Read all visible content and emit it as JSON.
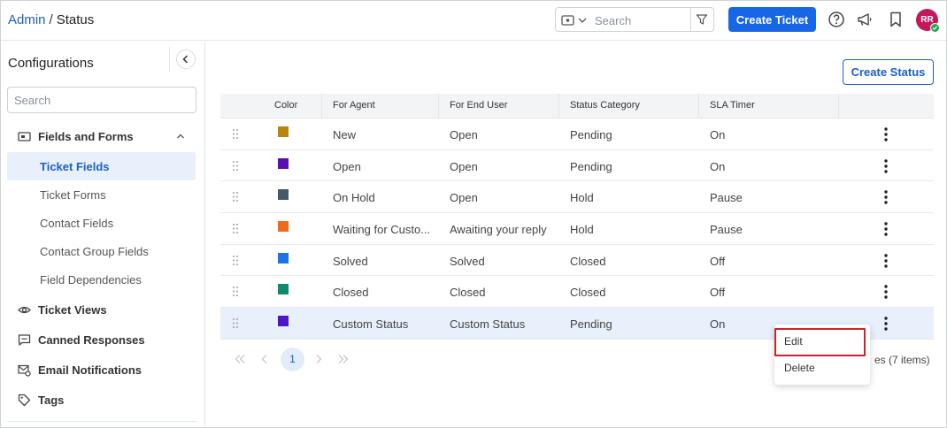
{
  "header": {
    "breadcrumb_root": "Admin",
    "breadcrumb_sep": "/",
    "breadcrumb_current": "Status",
    "search_placeholder": "Search",
    "create_ticket_label": "Create Ticket",
    "avatar_initials": "RR",
    "accent_color": "#1766e6"
  },
  "sidebar": {
    "title": "Configurations",
    "search_placeholder": "Search",
    "group_fields_forms": "Fields and Forms",
    "sub_items": [
      "Ticket Fields",
      "Ticket Forms",
      "Contact Fields",
      "Contact Group Fields",
      "Field Dependencies"
    ],
    "active_item": "Ticket Fields",
    "groups": [
      "Ticket Views",
      "Canned Responses",
      "Email Notifications",
      "Tags"
    ]
  },
  "main": {
    "create_status_label": "Create Status",
    "columns": [
      "Color",
      "For Agent",
      "For End User",
      "Status Category",
      "SLA Timer"
    ],
    "rows": [
      {
        "color": "#b9860c",
        "agent": "New",
        "end_user": "Open",
        "category": "Pending",
        "sla": "On"
      },
      {
        "color": "#5b0fb0",
        "agent": "Open",
        "end_user": "Open",
        "category": "Pending",
        "sla": "On"
      },
      {
        "color": "#475866",
        "agent": "On Hold",
        "end_user": "Open",
        "category": "Hold",
        "sla": "Pause"
      },
      {
        "color": "#f06a1a",
        "agent": "Waiting for Custo...",
        "end_user": "Awaiting your reply",
        "category": "Hold",
        "sla": "Pause"
      },
      {
        "color": "#1a73e8",
        "agent": "Solved",
        "end_user": "Solved",
        "category": "Closed",
        "sla": "Off"
      },
      {
        "color": "#0f8a6a",
        "agent": "Closed",
        "end_user": "Closed",
        "category": "Closed",
        "sla": "Off"
      },
      {
        "color": "#4a18c8",
        "agent": "Custom Status",
        "end_user": "Custom Status",
        "category": "Pending",
        "sla": "On"
      }
    ],
    "pager": {
      "current_page": "1",
      "count_text": "es (7 items)"
    },
    "menu": {
      "edit": "Edit",
      "delete": "Delete"
    }
  }
}
